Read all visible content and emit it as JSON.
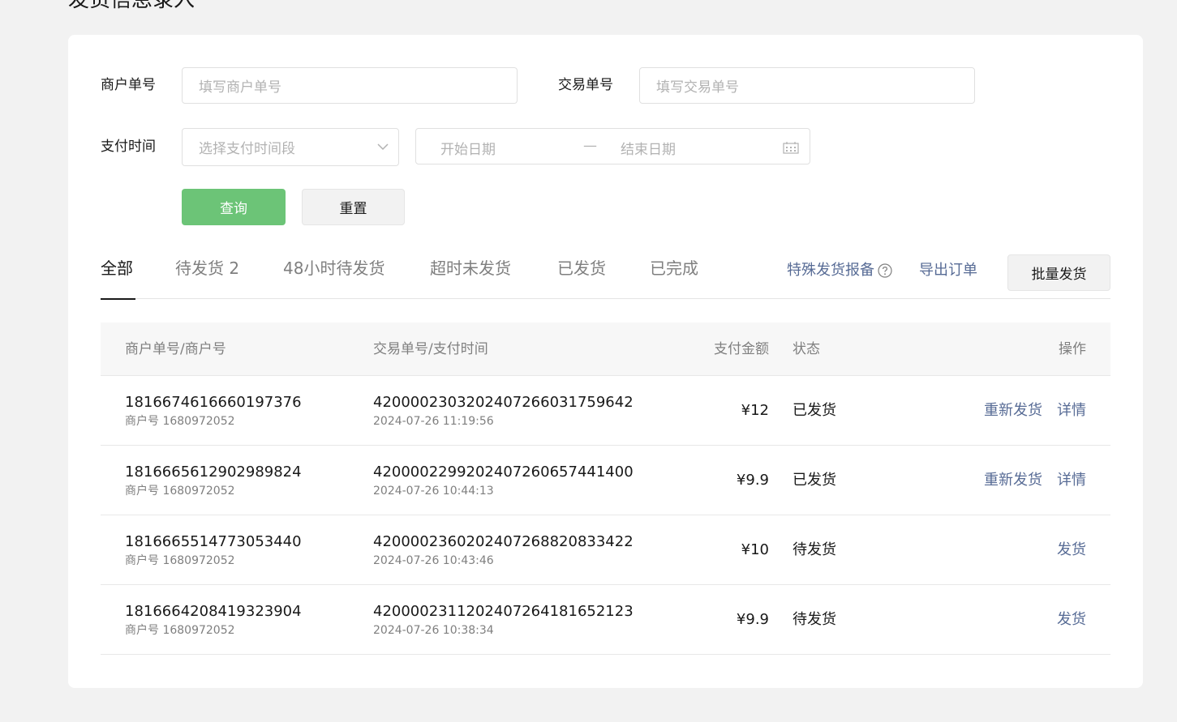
{
  "page": {
    "title": "发货信息录入"
  },
  "filters": {
    "merchant_order_label": "商户单号",
    "merchant_order_placeholder": "填写商户单号",
    "trade_order_label": "交易单号",
    "trade_order_placeholder": "填写交易单号",
    "pay_time_label": "支付时间",
    "pay_time_select_placeholder": "选择支付时间段",
    "start_date_placeholder": "开始日期",
    "date_separator": "—",
    "end_date_placeholder": "结束日期",
    "query_label": "查询",
    "reset_label": "重置"
  },
  "tabs": [
    {
      "label": "全部",
      "active": true
    },
    {
      "label": "待发货 2",
      "active": false
    },
    {
      "label": "48小时待发货",
      "active": false
    },
    {
      "label": "超时未发货",
      "active": false
    },
    {
      "label": "已发货",
      "active": false
    },
    {
      "label": "已完成",
      "active": false
    }
  ],
  "actions": {
    "special_report": "特殊发货报备",
    "export": "导出订单",
    "batch_ship": "批量发货"
  },
  "table": {
    "headers": {
      "merchant": "商户单号/商户号",
      "trade": "交易单号/支付时间",
      "amount": "支付金额",
      "status": "状态",
      "ops": "操作"
    },
    "rows": [
      {
        "merchant_order": "1816674616660197376",
        "merchant_id": "商户号 1680972052",
        "trade_order": "4200002303202407266031759642",
        "pay_time": "2024-07-26 11:19:56",
        "amount": "¥12",
        "status": "已发货",
        "ops": [
          "重新发货",
          "详情"
        ]
      },
      {
        "merchant_order": "1816665612902989824",
        "merchant_id": "商户号 1680972052",
        "trade_order": "4200002299202407260657441400",
        "pay_time": "2024-07-26 10:44:13",
        "amount": "¥9.9",
        "status": "已发货",
        "ops": [
          "重新发货",
          "详情"
        ]
      },
      {
        "merchant_order": "1816665514773053440",
        "merchant_id": "商户号 1680972052",
        "trade_order": "4200002360202407268820833422",
        "pay_time": "2024-07-26 10:43:46",
        "amount": "¥10",
        "status": "待发货",
        "ops": [
          "发货"
        ]
      },
      {
        "merchant_order": "1816664208419323904",
        "merchant_id": "商户号 1680972052",
        "trade_order": "4200002311202407264181652123",
        "pay_time": "2024-07-26 10:38:34",
        "amount": "¥9.9",
        "status": "待发货",
        "ops": [
          "发货"
        ]
      }
    ]
  },
  "colors": {
    "primary": "#6cc477",
    "link": "#576b95",
    "text": "#191919",
    "muted": "#7f7f7f"
  }
}
